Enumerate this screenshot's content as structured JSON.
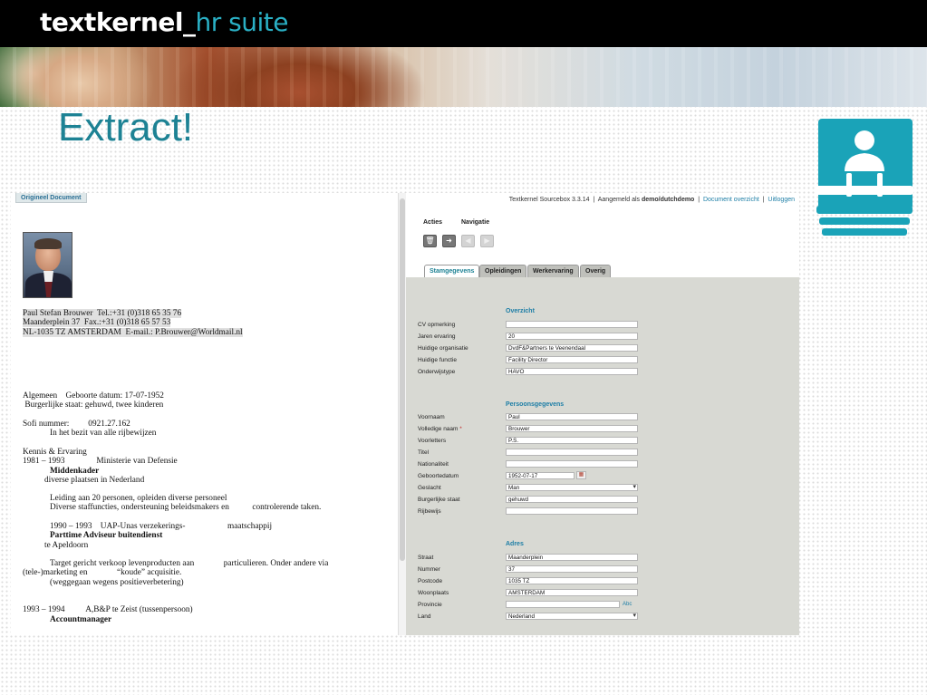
{
  "header": {
    "logo_main": "textkernel_",
    "logo_accent": "hr suite"
  },
  "slide_title": "Extract!",
  "left": {
    "tab_label": "Origineel Document",
    "lines": [
      "Paul Stefan Brouwer  Tel.:+31 (0)318 65 35 76",
      "Maanderplein 37  Fax.:+31 (0)318 65 57 53",
      "NL-1035 TZ AMSTERDAM  E-mail.: P.Brouwer@Worldmail.nl",
      "Algemeen    Geboorte datum: 17-07-1952",
      " Burgerlijke staat: gehuwd, twee kinderen",
      "Sofi nummer:         0921.27.162",
      "In het bezit van alle rijbewijzen",
      "Kennis & Ervaring",
      "1981 – 1993               Ministerie van Defensie",
      "Middenkader",
      "diverse plaatsen in Nederland",
      "Leiding aan 20 personen, opleiden diverse personeel",
      "Diverse staffuncties, ondersteuning beleidsmakers en           controlerende taken.",
      "1990 – 1993    UAP-Unas verzekerings-                    maatschappij",
      "Parttime Adviseur buitendienst",
      "te Apeldoorn",
      "Target gericht verkoop levenproducten aan              particulieren. Onder andere via",
      "(tele-)marketing en              “koude” acquisitie.",
      "(weggegaan wegens positieverbetering)",
      "1993 – 1994          A,B&P te Zeist (tussenpersoon)",
      "Accountmanager"
    ]
  },
  "right": {
    "topnav": {
      "version": "Textkernel Sourcebox 3.3.14",
      "logged_prefix": "Aangemeld als",
      "user": "demo/dutchdemo",
      "overview_link": "Document overzicht",
      "logout_link": "Uitloggen"
    },
    "menu": {
      "acties": "Acties",
      "navigatie": "Navigatie"
    },
    "tabs": [
      "Stamgegevens",
      "Opleidingen",
      "Werkervaring",
      "Overig"
    ],
    "sections": {
      "overzicht": "Overzicht",
      "persoonsgegevens": "Persoonsgegevens",
      "adres": "Adres"
    },
    "overzicht": [
      {
        "label": "CV opmerking",
        "value": ""
      },
      {
        "label": "Jaren ervaring",
        "value": "20"
      },
      {
        "label": "Huidige organisatie",
        "value": "DvdF&Partners te Veenendaal"
      },
      {
        "label": "Huidige functie",
        "value": "Facility Director"
      },
      {
        "label": "Onderwijstype",
        "value": "HAVO"
      }
    ],
    "persoons": [
      {
        "label": "Voornaam",
        "value": "Paul"
      },
      {
        "label": "Volledige naam",
        "required": "*",
        "value": "Brouwer"
      },
      {
        "label": "Voorletters",
        "value": "P.S."
      },
      {
        "label": "Titel",
        "value": ""
      },
      {
        "label": "Nationaliteit",
        "value": ""
      },
      {
        "label": "Geboortedatum",
        "value": "1952-07-17"
      },
      {
        "label": "Geslacht",
        "value": "Man"
      },
      {
        "label": "Burgerlijke staat",
        "value": "gehuwd"
      },
      {
        "label": "Rijbewijs",
        "value": ""
      }
    ],
    "adres": [
      {
        "label": "Straat",
        "value": "Maanderplein"
      },
      {
        "label": "Nummer",
        "value": "37"
      },
      {
        "label": "Postcode",
        "value": "1035 TZ"
      },
      {
        "label": "Woonplaats",
        "value": "AMSTERDAM"
      },
      {
        "label": "Provincie",
        "value": ""
      },
      {
        "label": "Land",
        "value": "Nederland"
      }
    ],
    "abc_label": "Abc"
  },
  "colors": {
    "accent": "#1d8294",
    "logo_accent": "#2ab0c5",
    "form_bg": "#d8d9d3"
  },
  "icons": [
    "contact-card-icon",
    "delete-icon",
    "forward-icon",
    "previous-icon",
    "next-icon",
    "calendar-icon"
  ]
}
